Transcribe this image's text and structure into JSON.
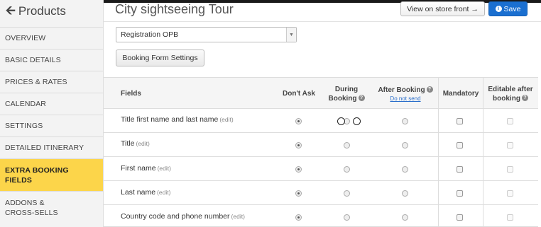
{
  "sidebar": {
    "title": "Products",
    "items": [
      {
        "label": "OVERVIEW",
        "active": false
      },
      {
        "label": "BASIC DETAILS",
        "active": false
      },
      {
        "label": "PRICES & RATES",
        "active": false
      },
      {
        "label": "CALENDAR",
        "active": false
      },
      {
        "label": "SETTINGS",
        "active": false
      },
      {
        "label": "DETAILED ITINERARY",
        "active": false
      },
      {
        "label": "EXTRA BOOKING FIELDS",
        "active": true
      },
      {
        "label": "ADDONS & CROSS-SELLS",
        "active": false
      }
    ]
  },
  "header": {
    "title": "City sightseeing Tour",
    "view_store_label": "View on store front →",
    "save_label": "Save"
  },
  "form_select": {
    "value": "Registration OPB"
  },
  "booking_form_button": "Booking Form Settings",
  "table": {
    "headers": {
      "fields": "Fields",
      "dont_ask": "Don't Ask",
      "during_booking_1": "During",
      "during_booking_2": "Booking",
      "after_booking": "After Booking",
      "do_not_send": "Do not send",
      "mandatory": "Mandatory",
      "editable_1": "Editable after",
      "editable_2": "booking"
    },
    "edit_label": "(edit)",
    "rows": [
      {
        "name": "Title first name and last name",
        "selected": "dont_ask"
      },
      {
        "name": "Title",
        "selected": "dont_ask"
      },
      {
        "name": "First name",
        "selected": "dont_ask"
      },
      {
        "name": "Last name",
        "selected": "dont_ask"
      },
      {
        "name": "Country code and phone number",
        "selected": "dont_ask"
      }
    ]
  },
  "colors": {
    "accent": "#1a6fd0",
    "active_item": "#fcd54a"
  }
}
